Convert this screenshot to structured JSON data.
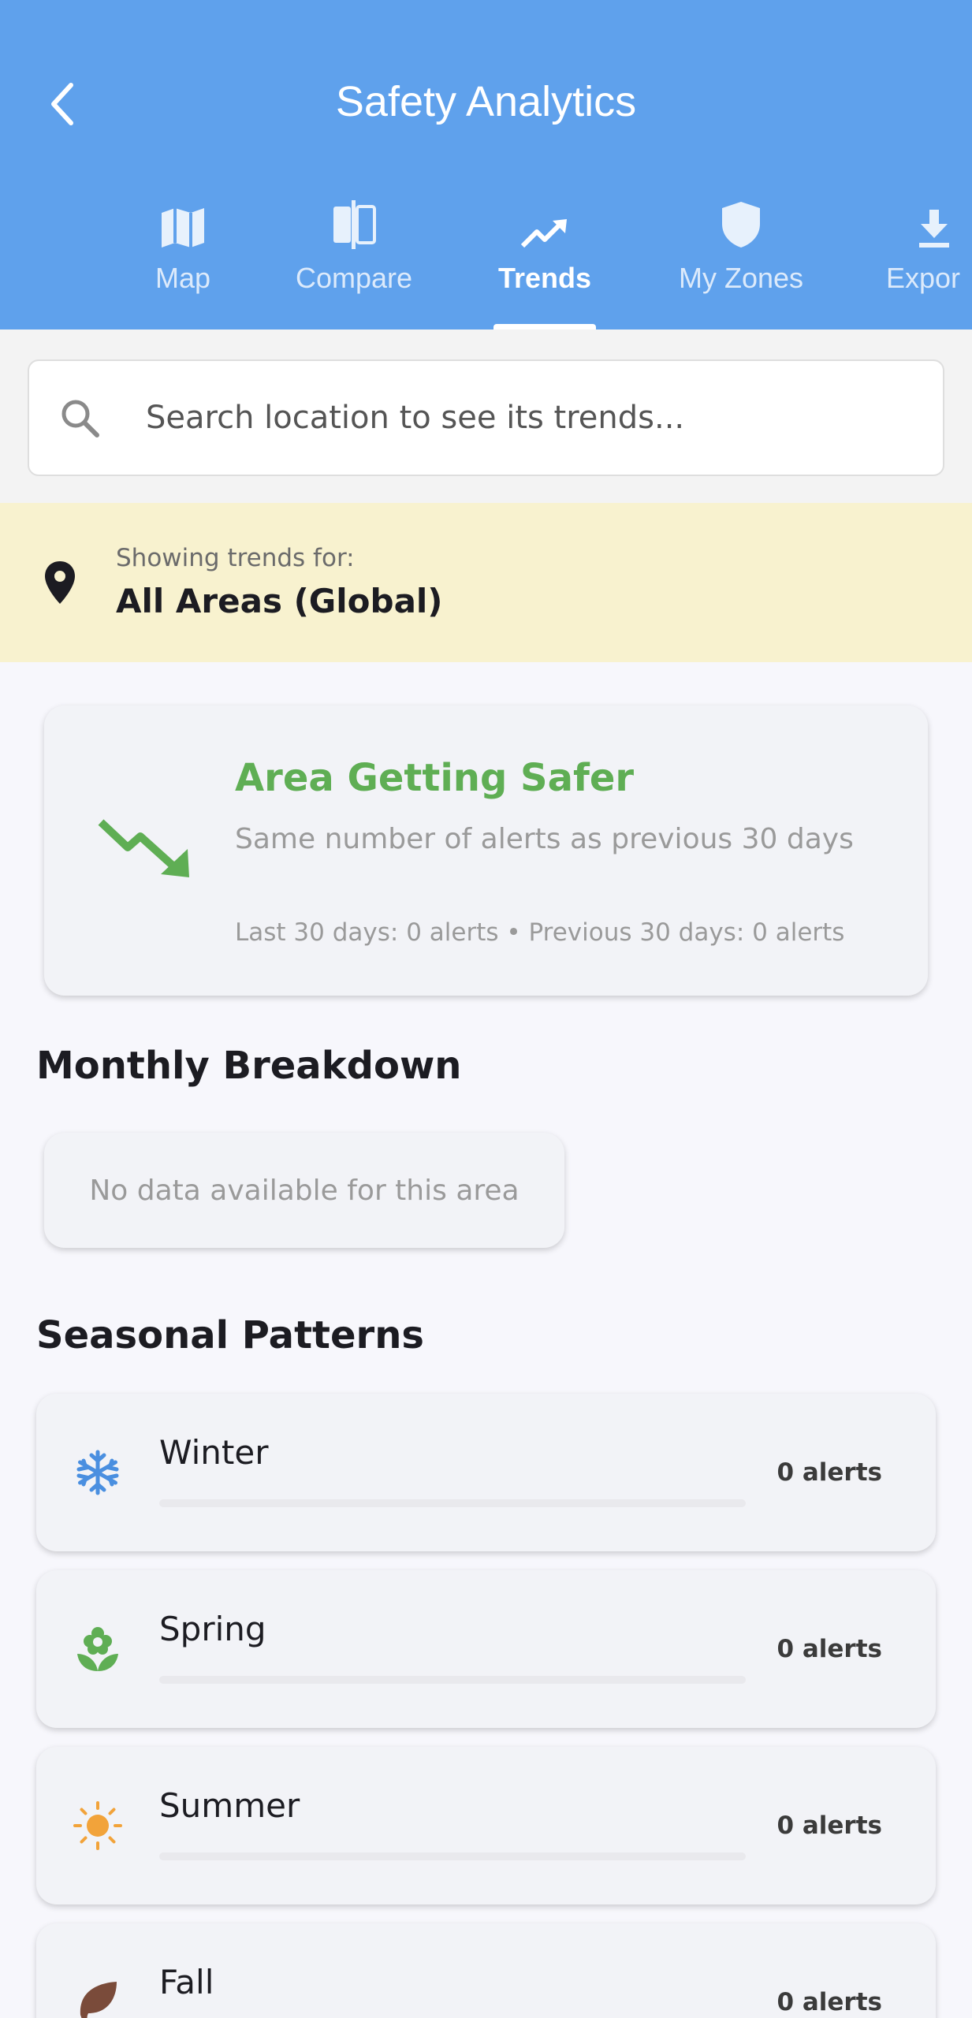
{
  "header": {
    "title": "Safety Analytics"
  },
  "tabs": [
    {
      "label": "Map",
      "icon": "map-icon",
      "active": false
    },
    {
      "label": "Compare",
      "icon": "compare-icon",
      "active": false
    },
    {
      "label": "Trends",
      "icon": "trending-up-icon",
      "active": true
    },
    {
      "label": "My Zones",
      "icon": "shield-icon",
      "active": false
    },
    {
      "label": "Expor",
      "icon": "download-icon",
      "active": false
    }
  ],
  "search": {
    "placeholder": "Search location to see its trends..."
  },
  "location": {
    "caption": "Showing trends for:",
    "value": "All Areas (Global)"
  },
  "trend": {
    "title": "Area Getting Safer",
    "description": "Same number of alerts as previous 30 days",
    "meta": "Last 30 days: 0 alerts • Previous 30 days: 0 alerts",
    "color": "#5fae54"
  },
  "monthly": {
    "title": "Monthly Breakdown",
    "empty_text": "No data available for this area"
  },
  "seasonal": {
    "title": "Seasonal Patterns",
    "items": [
      {
        "name": "Winter",
        "count_label": "0 alerts",
        "level": 0,
        "icon": "snowflake-icon",
        "color": "#4a8fe0"
      },
      {
        "name": "Spring",
        "count_label": "0 alerts",
        "level": 0,
        "icon": "flower-icon",
        "color": "#5fae54"
      },
      {
        "name": "Summer",
        "count_label": "0 alerts",
        "level": 0,
        "icon": "sun-icon",
        "color": "#f2a33a"
      },
      {
        "name": "Fall",
        "count_label": "0 alerts",
        "level": 0,
        "icon": "leaf-icon",
        "color": "#7a4b3a"
      }
    ]
  },
  "colors": {
    "appbar": "#5fa1ec",
    "location_bar": "#f8f2cf"
  }
}
